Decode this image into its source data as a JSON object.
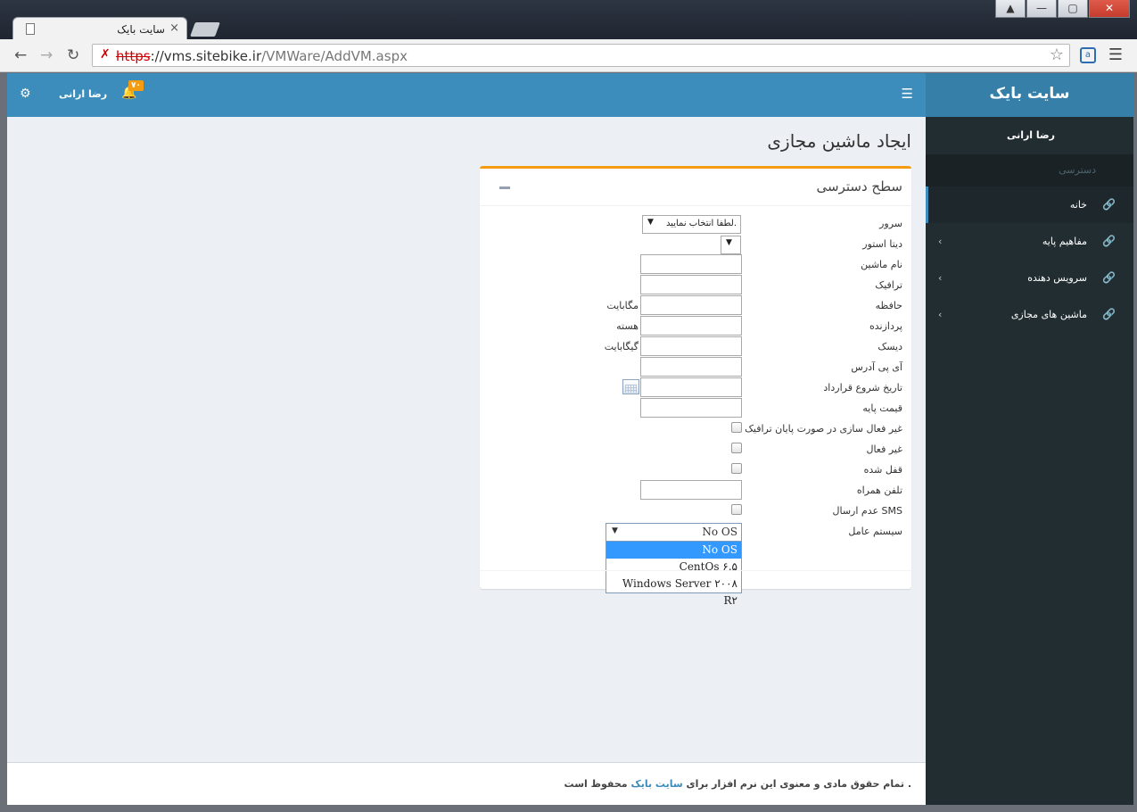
{
  "browser": {
    "tab_title": "سایت بایک",
    "tab_close": "×",
    "url_scheme": "https",
    "url_rest": "://vms.sitebike.ir",
    "url_path": "/VMWare/AddVM.aspx",
    "window_buttons": [
      "▲",
      "—",
      "▢",
      "✕"
    ]
  },
  "header": {
    "username": "رضا ارانی",
    "notification_count": "۷۰"
  },
  "sidebar": {
    "brand": "سایت بایک",
    "user": "رضا ارانی",
    "section_header": "دسترسی",
    "items": [
      {
        "label": "خانه",
        "active": true,
        "icon": "link-icon"
      },
      {
        "label": "مفاهیم پایه",
        "icon": "link-icon",
        "chevron": "‹"
      },
      {
        "label": "سرویس دهنده",
        "icon": "link-icon",
        "chevron": "‹"
      },
      {
        "label": "ماشین های مجازی",
        "icon": "link-icon",
        "chevron": "‹"
      }
    ]
  },
  "page": {
    "title": "ایجاد ماشین مجازی"
  },
  "form": {
    "box_title": "سطح دسترسی",
    "server_label": "سرور",
    "server_value": "لطفا انتخاب نمایید.",
    "datastore_label": "دیتا استور",
    "datastore_value": "",
    "machine_name_label": "نام ماشین",
    "traffic_label": "ترافیک",
    "memory_label": "حافظه",
    "memory_unit": "مگابایت",
    "cpu_label": "پردازنده",
    "cpu_unit": "هسته",
    "disk_label": "دیسک",
    "disk_unit": "گیگابایت",
    "ip_label": "آی پی آدرس",
    "start_date_label": "تاریخ شروع قرارداد",
    "base_price_label": "قیمت پایه",
    "disable_on_traffic_label": "غیر فعال سازی در صورت پایان ترافیک",
    "inactive_label": "غیر فعال",
    "locked_label": "قفل شده",
    "mobile_label": "تلفن همراه",
    "no_sms_label": "عدم ارسال SMS",
    "os_label": "سیستم عامل",
    "os_selected": "No OS",
    "os_options": [
      "No OS",
      "CentOs ۶.۵",
      "Windows Server ۲۰۰۸ R۲"
    ]
  },
  "footer": {
    "text_before": "تمام حقوق مادی و معنوی این نرم افزار برای",
    "link": "سایت بایک",
    "text_after": "محفوظ است ."
  },
  "colors": {
    "primary": "#3c8dbc",
    "sidebar": "#222d32",
    "warning": "#f39c12"
  }
}
